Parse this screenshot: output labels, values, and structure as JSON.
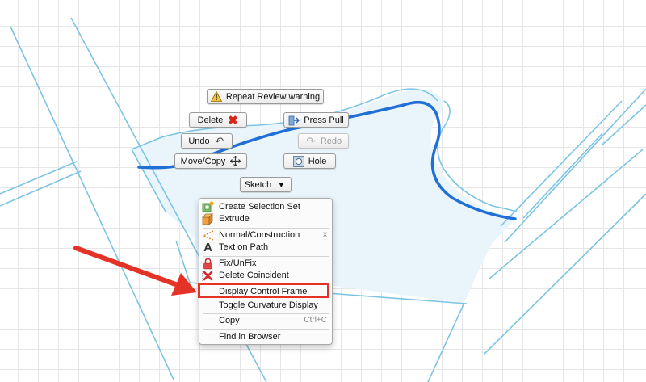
{
  "marking_menu": {
    "repeat_review": "Repeat Review warning",
    "delete": "Delete",
    "press_pull": "Press Pull",
    "undo": "Undo",
    "redo": "Redo",
    "move_copy": "Move/Copy",
    "hole": "Hole",
    "sketch": "Sketch"
  },
  "context_menu": {
    "items": [
      {
        "label": "Create Selection Set",
        "icon": "selection-set-icon"
      },
      {
        "label": "Extrude",
        "icon": "extrude-icon"
      },
      {
        "label": "Normal/Construction",
        "icon": "construction-icon",
        "right": "x"
      },
      {
        "label": "Text on Path",
        "icon": "text-on-path-icon"
      },
      {
        "label": "Fix/UnFix",
        "icon": "lock-icon"
      },
      {
        "label": "Delete Coincident",
        "icon": "delete-coincident-icon"
      },
      {
        "label": "Display Control Frame"
      },
      {
        "label": "Toggle Curvature Display"
      },
      {
        "label": "Copy",
        "shortcut": "Ctrl+C"
      },
      {
        "label": "Find in Browser"
      }
    ]
  },
  "colors": {
    "sketch_line": "#7cc4e4",
    "selected_curve": "#1f6fd6",
    "profile_fill": "#eaf5fb",
    "annotation_red": "#e53226"
  }
}
